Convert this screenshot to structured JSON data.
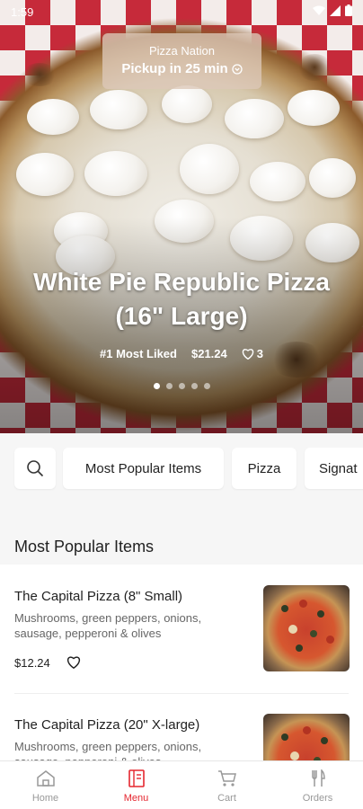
{
  "status_bar": {
    "time": "1:59"
  },
  "hero": {
    "store_name": "Pizza Nation",
    "pickup_text": "Pickup in 25 min",
    "title_line1": "White Pie Republic Pizza",
    "title_line2": "(16\" Large)",
    "badge": "#1 Most Liked",
    "price": "$21.24",
    "likes": "3",
    "carousel_count": 5,
    "carousel_active": 0
  },
  "categories": {
    "search_icon": "search-icon",
    "chips": [
      "Most Popular Items",
      "Pizza",
      "Signat"
    ]
  },
  "section": {
    "title": "Most Popular Items"
  },
  "items": [
    {
      "name": "The Capital Pizza (8\" Small)",
      "description": "Mushrooms, green peppers, onions, sausage, pepperoni & olives",
      "price": "$12.24"
    },
    {
      "name": "The Capital Pizza (20\" X-large)",
      "description": "Mushrooms, green peppers, onions, sausage, pepperoni & olives",
      "price": ""
    }
  ],
  "bottom_nav": [
    {
      "label": "Home",
      "icon": "home-icon"
    },
    {
      "label": "Menu",
      "icon": "menu-icon",
      "active": true
    },
    {
      "label": "Cart",
      "icon": "cart-icon"
    },
    {
      "label": "Orders",
      "icon": "orders-icon"
    }
  ],
  "colors": {
    "accent": "#e5262f",
    "background": "#f6f6f6"
  }
}
